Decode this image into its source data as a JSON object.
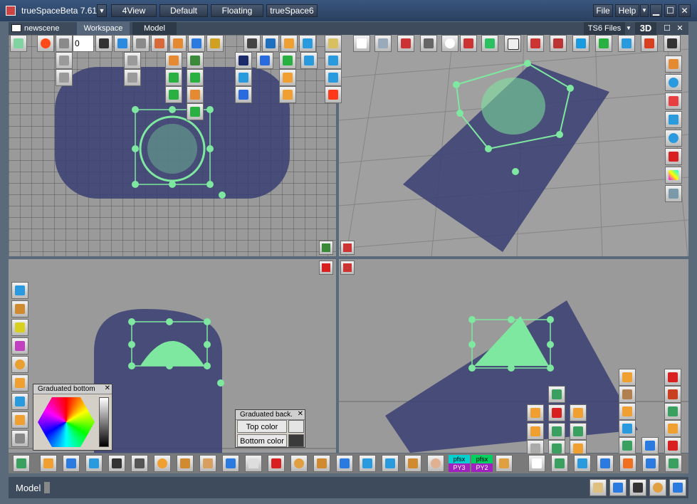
{
  "window": {
    "title": "trueSpaceBeta 7.61",
    "layout_tabs": [
      "4View",
      "Default",
      "Floating",
      "trueSpace6"
    ],
    "menu_file": "File",
    "menu_help": "Help"
  },
  "tabs": {
    "scene_name": "newscene",
    "workspace_tab": "Workspace",
    "model_tab": "Model",
    "ts6_files": "TS6 Files",
    "view_mode": "3D"
  },
  "frame_field": {
    "value": "0"
  },
  "panels": {
    "graduated_bottom_title": "Graduated bottom",
    "graduated_back_title": "Graduated back.",
    "top_color_label": "Top color",
    "bottom_color_label": "Bottom color"
  },
  "bottom_toolbar": {
    "pfsx_label_1": "pfsx",
    "py3_label": "PY3",
    "pfsx_label_2": "pfsx",
    "py2_label": "PY2"
  },
  "status": {
    "context": "Model"
  },
  "colors": {
    "mesh": "#3a3e72",
    "selection": "#7ee8a0",
    "viewport_bg": "#9a9a9a",
    "chrome": "#3e4b5c",
    "title_bar": "#2a4060"
  }
}
